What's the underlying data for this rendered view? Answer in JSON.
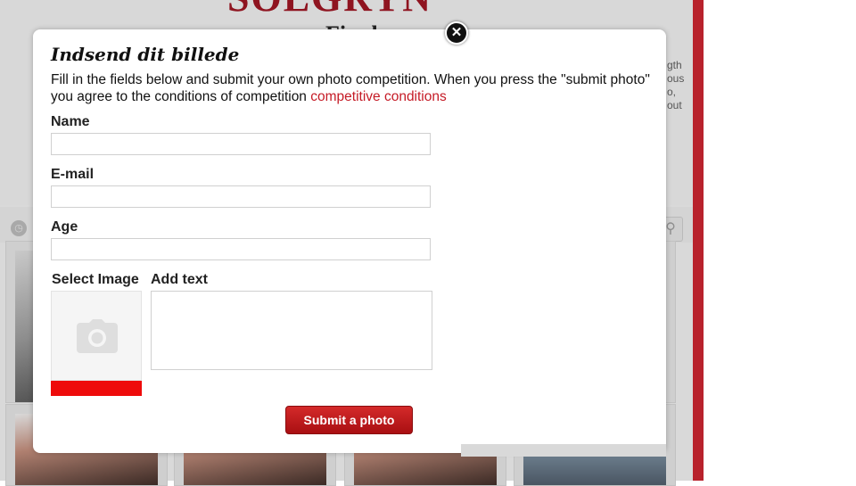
{
  "background": {
    "logo": "SOLGRYN",
    "heading": "Fin d",
    "side_text": [
      "gth",
      "ous",
      "o,",
      "out"
    ]
  },
  "modal": {
    "title": "Indsend dit billede",
    "intro_text": "Fill in the fields below and submit your own photo competition. When you press the \"submit photo\" you agree to the conditions of competition ",
    "intro_link": "competitive conditions",
    "close_symbol": "✕",
    "fields": {
      "name_label": "Name",
      "name_value": "",
      "email_label": "E-mail",
      "email_value": "",
      "age_label": "Age",
      "age_value": "",
      "image_label": "Select Image",
      "text_label": "Add text",
      "text_value": ""
    },
    "submit_label": "Submit a photo"
  },
  "colors": {
    "accent": "#c51b26",
    "button": "#b8181b",
    "image_bar": "#ee0b0b",
    "sidebar": "#b8222c"
  },
  "icons": {
    "close": "close-icon",
    "camera": "camera-icon",
    "clock": "clock-icon",
    "search": "search-icon"
  }
}
